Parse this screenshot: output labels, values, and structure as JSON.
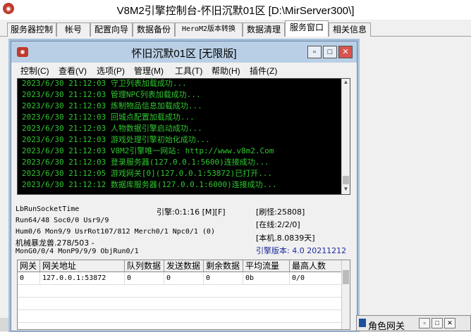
{
  "window": {
    "title": "V8M2引擎控制台-怀旧沉默01区 [D:\\MirServer300\\]",
    "icon_name": "app-icon"
  },
  "tabs": [
    {
      "label": "服务器控制"
    },
    {
      "label": "帐号"
    },
    {
      "label": "配置向导"
    },
    {
      "label": "数据备份"
    },
    {
      "label": "HeroM2版本转换"
    },
    {
      "label": "数据清理"
    },
    {
      "label": "服务窗口",
      "active": true
    },
    {
      "label": "相关信息"
    }
  ],
  "inner": {
    "title": "怀旧沉默01区 [无限版]",
    "min_label": "▫",
    "max_label": "□",
    "close_label": "✕",
    "menu": [
      "控制(C)",
      "查看(V)",
      "选项(P)",
      "管理(M)",
      "工具(T)",
      "帮助(H)",
      "插件(Z)"
    ]
  },
  "log": [
    "2023/6/30 21:12:03 守卫列表加载成功...",
    "2023/6/30 21:12:03 管理NPC列表加载成功...",
    "2023/6/30 21:12:03 炼制物品信息加载成功...",
    "2023/6/30 21:12:03 回城点配置加载成功...",
    "2023/6/30 21:12:03 人物数据引擎启动成功...",
    "2023/6/30 21:12:03 游戏处理引擎初始化成功...",
    "2023/6/30 21:12:03 V8M2引擎唯一网站: http://www.v8m2.Com",
    "2023/6/30 21:12:03 登录服务器(127.0.0.1:5600)连接成功...",
    "2023/6/30 21:12:05 游戏网关[0](127.0.0.1:53872)已打开...",
    "2023/6/30 21:12:12 数据库服务器(127.0.0.1:6000)连接成功..."
  ],
  "status": {
    "socket_time": "LbRunSocketTime",
    "engine": "引擎:0:1:16 [M][F]",
    "refresh": "[刷怪:25808]",
    "run": "Run64/48 Soc0/0 Usr9/9",
    "online": "[在线:2/2/0]",
    "hum": "Hum0/6 Mon9/9 UsrRot107/812 Merch0/1 Npc0/1 (0)",
    "local": "[本机.8.0839天]",
    "mech": "机械暴龙兽.278/503 -",
    "version": "引擎版本: 4.0 20211212",
    "mon": "MonG0/0/4 MonP9/9/9 ObjRun0/1"
  },
  "grid": {
    "headers": [
      "网关",
      "网关地址",
      "队列数据",
      "发送数据",
      "剩余数据",
      "平均流量",
      "最高人数"
    ],
    "rows": [
      [
        "0",
        "127.0.0.1:53872",
        "0",
        "0",
        "0",
        "0b",
        "0/0"
      ]
    ]
  },
  "bottom": {
    "label": "角色网关",
    "min_label": "▫",
    "max_label": "□",
    "close_label": "✕"
  }
}
